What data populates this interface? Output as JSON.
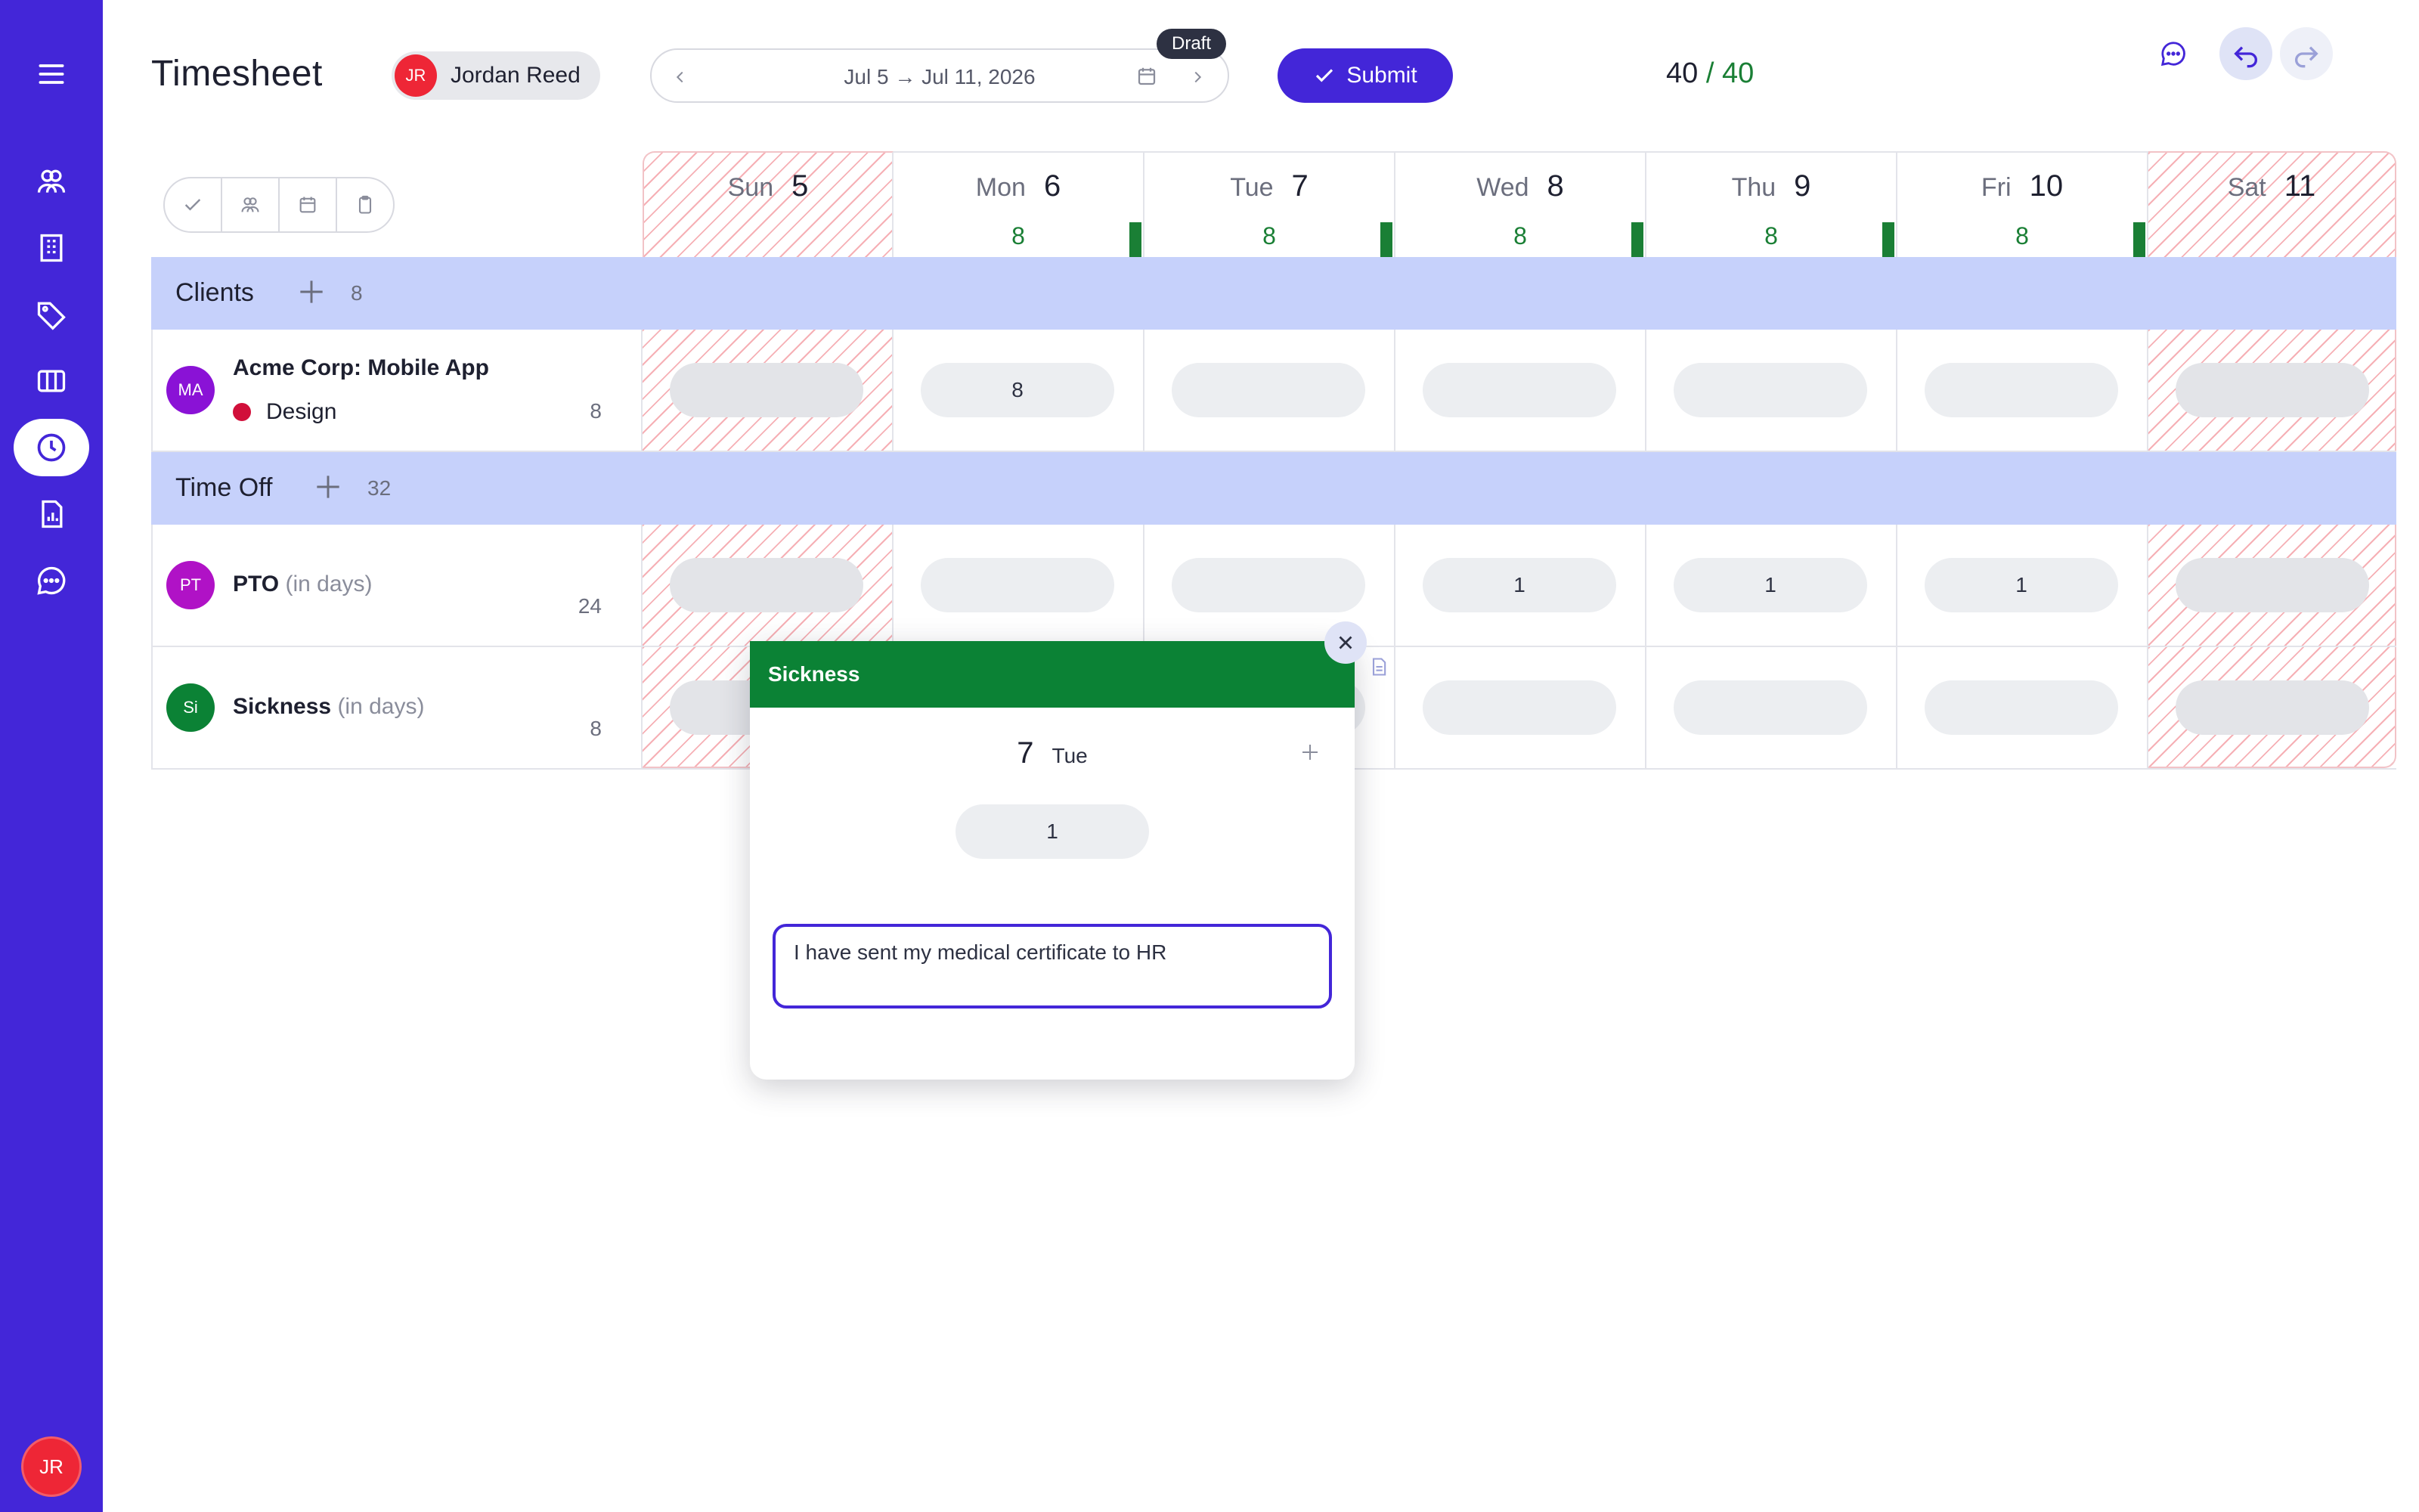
{
  "app": {
    "title": "Timesheet"
  },
  "user": {
    "initials": "JR",
    "name": "Jordan Reed"
  },
  "week": {
    "range": "Jul 5 → Jul 11, 2026",
    "status": "Draft"
  },
  "actions": {
    "submit": "Submit"
  },
  "totals": {
    "logged": "40",
    "separator": "/",
    "expected": "40"
  },
  "days": [
    {
      "name": "Sun",
      "num": "5",
      "hours": "",
      "weekend": true
    },
    {
      "name": "Mon",
      "num": "6",
      "hours": "8",
      "weekend": false
    },
    {
      "name": "Tue",
      "num": "7",
      "hours": "8",
      "weekend": false
    },
    {
      "name": "Wed",
      "num": "8",
      "hours": "8",
      "weekend": false
    },
    {
      "name": "Thu",
      "num": "9",
      "hours": "8",
      "weekend": false
    },
    {
      "name": "Fri",
      "num": "10",
      "hours": "8",
      "weekend": false
    },
    {
      "name": "Sat",
      "num": "11",
      "hours": "",
      "weekend": true
    }
  ],
  "sections": {
    "clients": {
      "label": "Clients",
      "count": "8"
    },
    "time_off": {
      "label": "Time Off",
      "count": "32"
    }
  },
  "rows": {
    "acme": {
      "initials": "MA",
      "title": "Acme Corp: Mobile App",
      "task": "Design",
      "total": "8",
      "values": [
        "",
        "8",
        "",
        "",
        "",
        "",
        ""
      ]
    },
    "pto": {
      "initials": "PT",
      "title": "PTO",
      "unit": "(in days)",
      "total": "24",
      "values": [
        "",
        "",
        "",
        "1",
        "1",
        "1",
        ""
      ]
    },
    "sickness": {
      "initials": "Si",
      "title": "Sickness",
      "unit": "(in days)",
      "total": "8",
      "values": [
        "",
        "",
        "",
        "",
        "",
        "",
        ""
      ]
    }
  },
  "popover": {
    "title": "Sickness",
    "day_num": "7",
    "day_name": "Tue",
    "value": "1",
    "note": "I have sent my medical certificate to HR"
  },
  "colors": {
    "primary": "#4326d8",
    "success": "#1a7f35",
    "band": "#c6d1fb",
    "danger": "#ee2636"
  }
}
